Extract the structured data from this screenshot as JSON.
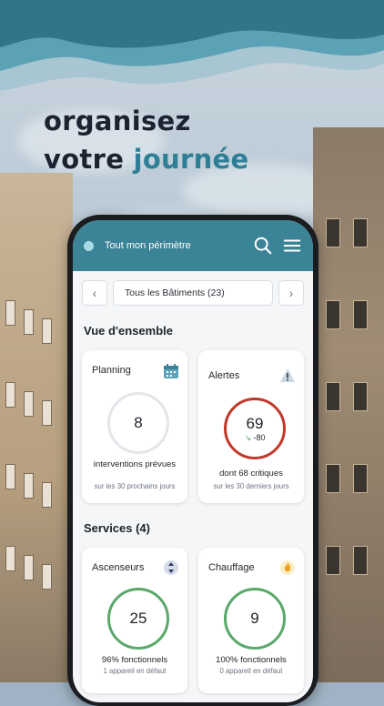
{
  "headline": {
    "line1": "organisez",
    "line2_plain": "votre",
    "line2_accent": "journée"
  },
  "appbar": {
    "title": "Tout mon périmètre",
    "search_icon": "search-icon",
    "menu_icon": "menu-icon"
  },
  "filter": {
    "prev": "‹",
    "value": "Tous les Bâtiments (23)",
    "next": "›"
  },
  "overview": {
    "heading": "Vue d'ensemble",
    "planning": {
      "title": "Planning",
      "icon": "calendar-icon",
      "value": "8",
      "label": "interventions prévues",
      "sub": "sur les 30 prochains jours"
    },
    "alerts": {
      "title": "Alertes",
      "icon": "warning-icon",
      "value": "69",
      "delta": "-80",
      "label": "dont 68 critiques",
      "sub": "sur les 30 derniers jours"
    }
  },
  "services": {
    "heading": "Services (4)",
    "items": [
      {
        "title": "Ascenseurs",
        "icon": "elevator-icon",
        "value": "25",
        "label": "96% fonctionnels",
        "sub": "1 appareil en défaut"
      },
      {
        "title": "Chauffage",
        "icon": "flame-icon",
        "value": "9",
        "label": "100% fonctionnels",
        "sub": "0 appareil en défaut"
      }
    ]
  },
  "colors": {
    "accent": "#2e7f96",
    "appbar": "#3b8396",
    "alert_ring": "#c0392b",
    "ok_ring": "#5aa86a",
    "neutral_ring": "#e3e6ea"
  }
}
